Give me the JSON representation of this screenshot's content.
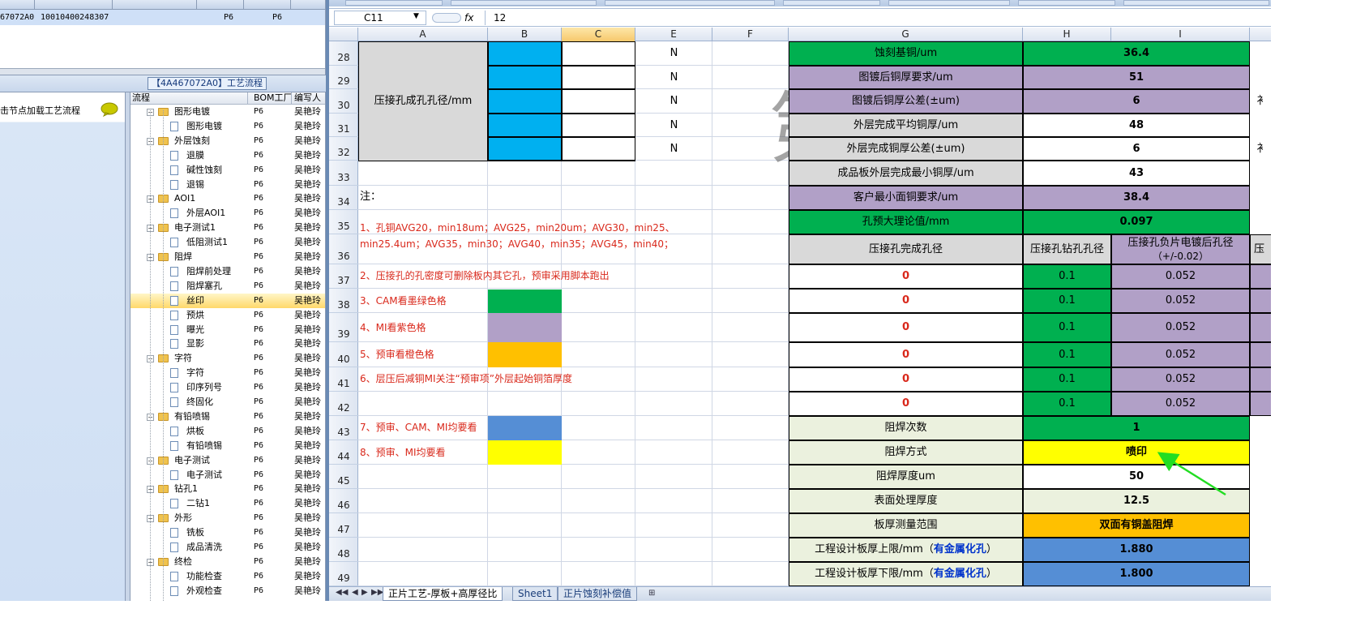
{
  "top_table": {
    "row": [
      "67072A0",
      "10010400248307",
      "P6",
      "P6"
    ]
  },
  "flow": {
    "title": "【4A467072A0】工艺流程",
    "hint": "击节点加载工艺流程"
  },
  "tree": {
    "headers": [
      "流程",
      "BOM工厂",
      "编写人"
    ],
    "rows": [
      {
        "name": "图形电镀",
        "level": 0,
        "fac": "P6",
        "who": "吴艳玲"
      },
      {
        "name": "图形电镀",
        "level": 1,
        "fac": "P6",
        "who": "吴艳玲"
      },
      {
        "name": "外层蚀刻",
        "level": 0,
        "fac": "P6",
        "who": "吴艳玲"
      },
      {
        "name": "退膜",
        "level": 1,
        "fac": "P6",
        "who": "吴艳玲"
      },
      {
        "name": "碱性蚀刻",
        "level": 1,
        "fac": "P6",
        "who": "吴艳玲"
      },
      {
        "name": "退锡",
        "level": 1,
        "fac": "P6",
        "who": "吴艳玲"
      },
      {
        "name": "AOI1",
        "level": 0,
        "fac": "P6",
        "who": "吴艳玲"
      },
      {
        "name": "外层AOI1",
        "level": 1,
        "fac": "P6",
        "who": "吴艳玲"
      },
      {
        "name": "电子测试1",
        "level": 0,
        "fac": "P6",
        "who": "吴艳玲"
      },
      {
        "name": "低阻测试1",
        "level": 1,
        "fac": "P6",
        "who": "吴艳玲"
      },
      {
        "name": "阻焊",
        "level": 0,
        "fac": "P6",
        "who": "吴艳玲"
      },
      {
        "name": "阻焊前处理",
        "level": 1,
        "fac": "P6",
        "who": "吴艳玲"
      },
      {
        "name": "阻焊塞孔",
        "level": 1,
        "fac": "P6",
        "who": "吴艳玲"
      },
      {
        "name": "丝印",
        "level": 1,
        "fac": "P6",
        "who": "吴艳玲",
        "selected": true
      },
      {
        "name": "预烘",
        "level": 1,
        "fac": "P6",
        "who": "吴艳玲"
      },
      {
        "name": "曝光",
        "level": 1,
        "fac": "P6",
        "who": "吴艳玲"
      },
      {
        "name": "显影",
        "level": 1,
        "fac": "P6",
        "who": "吴艳玲"
      },
      {
        "name": "字符",
        "level": 0,
        "fac": "P6",
        "who": "吴艳玲"
      },
      {
        "name": "字符",
        "level": 1,
        "fac": "P6",
        "who": "吴艳玲"
      },
      {
        "name": "印序列号",
        "level": 1,
        "fac": "P6",
        "who": "吴艳玲"
      },
      {
        "name": "终固化",
        "level": 1,
        "fac": "P6",
        "who": "吴艳玲"
      },
      {
        "name": "有铅喷锡",
        "level": 0,
        "fac": "P6",
        "who": "吴艳玲"
      },
      {
        "name": "烘板",
        "level": 1,
        "fac": "P6",
        "who": "吴艳玲"
      },
      {
        "name": "有铅喷锡",
        "level": 1,
        "fac": "P6",
        "who": "吴艳玲"
      },
      {
        "name": "电子测试",
        "level": 0,
        "fac": "P6",
        "who": "吴艳玲"
      },
      {
        "name": "电子测试",
        "level": 1,
        "fac": "P6",
        "who": "吴艳玲"
      },
      {
        "name": "钻孔1",
        "level": 0,
        "fac": "P6",
        "who": "吴艳玲"
      },
      {
        "name": "二钻1",
        "level": 1,
        "fac": "P6",
        "who": "吴艳玲"
      },
      {
        "name": "外形",
        "level": 0,
        "fac": "P6",
        "who": "吴艳玲"
      },
      {
        "name": "铣板",
        "level": 1,
        "fac": "P6",
        "who": "吴艳玲"
      },
      {
        "name": "成品清洗",
        "level": 1,
        "fac": "P6",
        "who": "吴艳玲"
      },
      {
        "name": "终检",
        "level": 0,
        "fac": "P6",
        "who": "吴艳玲"
      },
      {
        "name": "功能检查",
        "level": 1,
        "fac": "P6",
        "who": "吴艳玲"
      },
      {
        "name": "外观检查",
        "level": 1,
        "fac": "P6",
        "who": "吴艳玲"
      }
    ]
  },
  "formula_bar": {
    "cell_ref": "C11",
    "fx": "fx",
    "value": "12"
  },
  "columns": [
    "A",
    "B",
    "C",
    "E",
    "F",
    "G",
    "H",
    "I"
  ],
  "rows": [
    "28",
    "29",
    "30",
    "31",
    "32",
    "33",
    "34",
    "35",
    "36",
    "37",
    "38",
    "39",
    "40",
    "41",
    "42",
    "43",
    "44",
    "45",
    "46",
    "47",
    "48",
    "49"
  ],
  "left_block": {
    "label": "压接孔成孔孔径/mm",
    "e_values": [
      "N",
      "N",
      "N",
      "N",
      "N"
    ],
    "note_label": "注："
  },
  "notes": [
    "1、孔铜AVG20，min18um；AVG25，min20um；AVG30，min25、",
    "min25.4um；AVG35，min30；AVG40，min35；AVG45，min40；",
    "2、压接孔的孔密度可删除板内其它孔，预审采用脚本跑出",
    "3、CAM看墨绿色格",
    "4、MI看紫色格",
    "5、预审看橙色格",
    "6、层压后减铜MI关注“预审项”外层起始铜箔厚度",
    "7、预审、CAM、MI均要看",
    "8、预审、MI均要看"
  ],
  "right_params": [
    {
      "label": "蚀刻基铜/um",
      "value": "36.4",
      "label_bg": "#00b050",
      "value_bg": "#00b050"
    },
    {
      "label": "图镀后铜厚要求/um",
      "value": "51",
      "label_bg": "#b1a0c7",
      "value_bg": "#b1a0c7"
    },
    {
      "label": "图镀后铜厚公差(±um)",
      "value": "6",
      "label_bg": "#b1a0c7",
      "value_bg": "#b1a0c7",
      "extra": "衤"
    },
    {
      "label": "外层完成平均铜厚/um",
      "value": "48",
      "label_bg": "#d9d9d9",
      "value_bg": "#ffffff"
    },
    {
      "label": "外层完成铜厚公差(±um)",
      "value": "6",
      "label_bg": "#d9d9d9",
      "value_bg": "#ffffff",
      "extra": "衤"
    },
    {
      "label": "成品板外层完成最小铜厚/um",
      "value": "43",
      "label_bg": "#d9d9d9",
      "value_bg": "#ffffff"
    },
    {
      "label": "客户最小面铜要求/um",
      "value": "38.4",
      "label_bg": "#b1a0c7",
      "value_bg": "#b1a0c7"
    },
    {
      "label": "孔预大理论值/mm",
      "value": "0.097",
      "label_bg": "#00b050",
      "value_bg": "#00b050"
    }
  ],
  "hole_table": {
    "headers": [
      "压接孔完成孔径",
      "压接孔钻孔孔径",
      "压接孔负片电镀后孔径",
      "（+/-0.02）",
      "压"
    ],
    "rows": [
      [
        "0",
        "0.1",
        "0.052"
      ],
      [
        "0",
        "0.1",
        "0.052"
      ],
      [
        "0",
        "0.1",
        "0.052"
      ],
      [
        "0",
        "0.1",
        "0.052"
      ],
      [
        "0",
        "0.1",
        "0.052"
      ],
      [
        "0",
        "0.1",
        "0.052"
      ]
    ]
  },
  "solder_params": [
    {
      "label": "阻焊次数",
      "value": "1",
      "value_bg": "#00b050"
    },
    {
      "label": "阻焊方式",
      "value": "喷印",
      "value_bg": "#ffff00"
    },
    {
      "label": "阻焊厚度um",
      "value": "50",
      "value_bg": "#ffffff"
    },
    {
      "label": "表面处理厚度",
      "value": "12.5",
      "value_bg": "#ebf1de"
    },
    {
      "label": "板厚测量范围",
      "value": "双面有铜盖阻焊",
      "value_bg": "#ffc000"
    },
    {
      "label_pre": "工程设计板厚上限/mm（",
      "label_em": "有金属化孔",
      "label_post": "）",
      "value": "1.880",
      "value_bg": "#558ed5"
    },
    {
      "label_pre": "工程设计板厚下限/mm（",
      "label_em": "有金属化孔",
      "label_post": "）",
      "value": "1.800",
      "value_bg": "#558ed5"
    }
  ],
  "watermark": "第 1 页",
  "sheet_tabs": [
    "正片工艺-厚板+高厚径比",
    "Sheet1",
    "正片蚀刻补偿值"
  ],
  "colors": {
    "green": "#00b050",
    "purple": "#b1a0c7",
    "orange": "#ffc000",
    "blue": "#558ed5",
    "yellow": "#ffff00",
    "cyan": "#00b0f0",
    "note_red": "#d9281b",
    "emph_blue": "#0033cc"
  }
}
